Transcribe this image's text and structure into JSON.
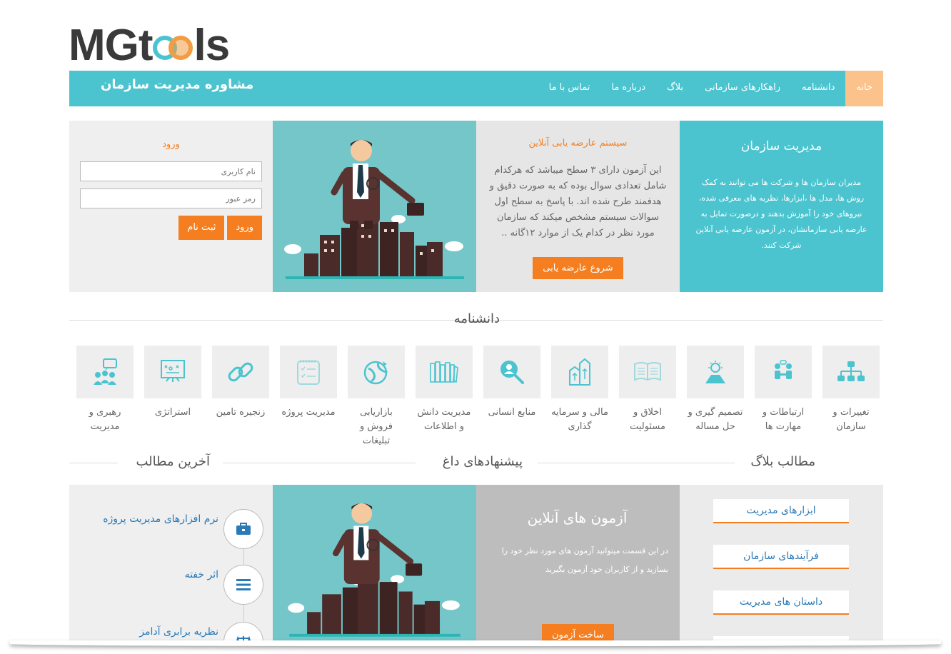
{
  "brand": {
    "logo_left": "MGt",
    "logo_right": "ls"
  },
  "nav": {
    "title": "مشاوره مدیریت سازمان",
    "items": [
      {
        "label": "خانه",
        "active": true
      },
      {
        "label": "دانشنامه"
      },
      {
        "label": "راهکارهای سازمانی"
      },
      {
        "label": "بلاگ"
      },
      {
        "label": "درباره ما"
      },
      {
        "label": "تماس با ما"
      }
    ]
  },
  "intro": {
    "title": "مدیریت سازمان",
    "text": "مدیران سازمان ها و شرکت ها می توانند به کمک روش ها، مدل ها ،ابزارها، نظریه های معرفی شده، نیروهای خود را آموزش بدهند و درصورت تمایل به عارضه یابی سازمانشان، در آزمون عارضه یابی آنلاین شرکت کنند."
  },
  "assessment": {
    "title": "سیستم عارضه یابی آنلاین",
    "text": "این آزمون دارای ۳ سطح میباشد که هرکدام شامل تعدادی سوال بوده که به صورت دقیق و هدفمند طرح شده اند. با پاسخ به سطح اول سوالات سیستم مشخص میکند که سازمان مورد نظر در کدام یک از موارد ۱۲گانه ..",
    "button": "شروع عارضه یابی"
  },
  "login": {
    "title": "ورود",
    "username_placeholder": "نام کاربری",
    "password_placeholder": "رمز عبور",
    "login_button": "ورود",
    "register_button": "ثبت نام"
  },
  "encyclopedia": {
    "title": "دانشنامه",
    "items": [
      {
        "label": "تغییرات و سازمان",
        "icon": "org-chart-icon"
      },
      {
        "label": "ارتباطات و مهارت ها",
        "icon": "communication-icon"
      },
      {
        "label": "تصمیم گیری و حل مساله",
        "icon": "decision-bulb-icon"
      },
      {
        "label": "اخلاق و مسئولیت",
        "icon": "open-book-icon"
      },
      {
        "label": "مالی و سرمایه گذاری",
        "icon": "finance-buildings-icon"
      },
      {
        "label": "منابع انسانی",
        "icon": "hr-search-icon"
      },
      {
        "label": "مدیریت دانش و اطلاعات",
        "icon": "books-icon"
      },
      {
        "label": "بازاریابی فروش و تبلیغات",
        "icon": "globe-marketing-icon"
      },
      {
        "label": "مدیریت پروژه",
        "icon": "checklist-icon"
      },
      {
        "label": "زنجیره تامین",
        "icon": "chain-link-icon"
      },
      {
        "label": "استراتژی",
        "icon": "strategy-board-icon"
      },
      {
        "label": "رهبری و مدیریت",
        "icon": "leadership-icon"
      }
    ]
  },
  "sections": {
    "blog": "مطالب بلاگ",
    "hot": "پیشنهادهای داغ",
    "latest": "آخرین مطالب"
  },
  "blog_categories": [
    "ابزارهای مدیریت",
    "فرآیندهای سازمان",
    "داستان های مدیریت"
  ],
  "online_tests": {
    "title": "آزمون های آنلاین",
    "text": "در این قسمت میتوانید آزمون های مورد نظر خود را بسازید و از کاربران خود آزمون بگیرید",
    "button": "ساخت آزمون"
  },
  "latest_posts": [
    {
      "title": "نرم افزارهای مدیریت پروژه",
      "icon": "briefcase-icon"
    },
    {
      "title": "اثر خفته",
      "icon": "menu-lines-icon"
    },
    {
      "title": "نظریه برابری آدامز",
      "icon": "scales-icon"
    }
  ],
  "colors": {
    "teal": "#4bc4cf",
    "orange": "#f57f20",
    "active_tab": "#fbc28b"
  }
}
